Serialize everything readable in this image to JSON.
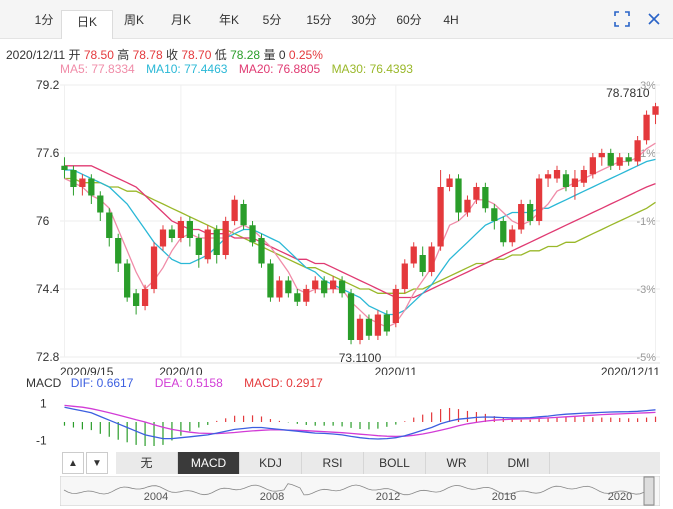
{
  "tabs": [
    "1分",
    "日K",
    "周K",
    "月K",
    "年K",
    "5分",
    "15分",
    "30分",
    "60分",
    "4H"
  ],
  "active_tab": 1,
  "header": {
    "date": "2020/12/11",
    "open_label": "开",
    "open": "78.50",
    "high_label": "高",
    "high": "78.78",
    "close_label": "收",
    "close": "78.70",
    "low_label": "低",
    "low": "78.28",
    "vol_label": "量",
    "vol": "0",
    "change": "0.25%"
  },
  "ma_legend": {
    "ma5": "MA5: 77.8334",
    "ma10": "MA10: 77.4463",
    "ma20": "MA20: 76.8805",
    "ma30": "MA30: 76.4393"
  },
  "colors": {
    "up": "#e4393c",
    "down": "#2a9d2a",
    "ma5": "#f08ca8",
    "ma10": "#2ab8d6",
    "ma20": "#e03a72",
    "ma30": "#9ab82a",
    "dif": "#3c5fe0",
    "dea": "#d23cd6"
  },
  "chart_data": {
    "type": "candlestick",
    "ylim": [
      72.8,
      79.2
    ],
    "y_ticks": [
      "79.2",
      "77.6",
      "76",
      "74.4",
      "72.8"
    ],
    "pct_ticks": [
      "3%",
      "1%",
      "-1%",
      "-3%",
      "-5%"
    ],
    "x_ticks": [
      {
        "label": "2020/9/15",
        "index": 0
      },
      {
        "label": "2020/10",
        "index": 13
      },
      {
        "label": "2020/11",
        "index": 37
      },
      {
        "label": "2020/12/11",
        "index": 66
      }
    ],
    "annotations": {
      "max_label": "78.7810",
      "min_label": "73.1100"
    },
    "candles": [
      [
        77.3,
        77.2,
        77.5,
        77.0
      ],
      [
        77.2,
        76.8,
        77.3,
        76.6
      ],
      [
        76.8,
        77.0,
        77.1,
        76.6
      ],
      [
        77.0,
        76.6,
        77.1,
        76.4
      ],
      [
        76.6,
        76.2,
        76.7,
        76.0
      ],
      [
        76.2,
        75.6,
        76.3,
        75.4
      ],
      [
        75.6,
        75.0,
        75.7,
        74.8
      ],
      [
        75.0,
        74.2,
        75.1,
        74.1
      ],
      [
        74.3,
        74.0,
        74.4,
        73.8
      ],
      [
        74.0,
        74.4,
        74.5,
        73.9
      ],
      [
        74.4,
        75.4,
        75.5,
        74.3
      ],
      [
        75.4,
        75.8,
        75.9,
        75.3
      ],
      [
        75.8,
        75.6,
        75.9,
        75.5
      ],
      [
        75.6,
        76.0,
        76.1,
        75.5
      ],
      [
        76.0,
        75.6,
        76.1,
        75.4
      ],
      [
        75.6,
        75.2,
        75.7,
        74.9
      ],
      [
        75.1,
        75.8,
        75.9,
        75.0
      ],
      [
        75.8,
        75.2,
        75.9,
        75.0
      ],
      [
        75.2,
        76.0,
        76.1,
        75.1
      ],
      [
        76.0,
        76.5,
        76.6,
        75.9
      ],
      [
        76.4,
        75.9,
        76.5,
        75.8
      ],
      [
        75.9,
        75.5,
        76.0,
        75.4
      ],
      [
        75.6,
        75.0,
        75.7,
        74.9
      ],
      [
        75.0,
        74.2,
        75.1,
        74.1
      ],
      [
        74.2,
        74.6,
        74.7,
        74.1
      ],
      [
        74.6,
        74.3,
        74.7,
        74.2
      ],
      [
        74.3,
        74.1,
        74.4,
        74.0
      ],
      [
        74.1,
        74.4,
        74.5,
        74.0
      ],
      [
        74.4,
        74.6,
        74.7,
        74.3
      ],
      [
        74.6,
        74.3,
        74.7,
        74.2
      ],
      [
        74.4,
        74.6,
        74.7,
        74.3
      ],
      [
        74.6,
        74.3,
        74.7,
        74.2
      ],
      [
        74.3,
        73.2,
        74.4,
        73.1
      ],
      [
        73.2,
        73.7,
        73.8,
        73.1
      ],
      [
        73.7,
        73.3,
        73.8,
        73.2
      ],
      [
        73.3,
        73.8,
        73.9,
        73.2
      ],
      [
        73.8,
        73.4,
        73.9,
        73.3
      ],
      [
        73.6,
        74.4,
        74.5,
        73.5
      ],
      [
        74.4,
        75.0,
        75.1,
        74.3
      ],
      [
        75.0,
        75.4,
        75.5,
        74.9
      ],
      [
        75.2,
        74.8,
        75.4,
        74.7
      ],
      [
        74.8,
        75.4,
        75.5,
        74.7
      ],
      [
        75.4,
        76.8,
        77.2,
        75.3
      ],
      [
        76.8,
        77.0,
        77.1,
        76.7
      ],
      [
        77.0,
        76.2,
        77.1,
        76.0
      ],
      [
        76.2,
        76.5,
        76.6,
        76.1
      ],
      [
        76.5,
        76.8,
        76.9,
        76.4
      ],
      [
        76.8,
        76.3,
        76.9,
        76.2
      ],
      [
        76.3,
        76.0,
        76.4,
        75.8
      ],
      [
        76.0,
        75.5,
        76.1,
        75.4
      ],
      [
        75.5,
        75.8,
        75.9,
        75.4
      ],
      [
        75.8,
        76.4,
        76.5,
        75.7
      ],
      [
        76.4,
        76.0,
        76.5,
        75.9
      ],
      [
        76.0,
        77.0,
        77.1,
        75.9
      ],
      [
        77.0,
        77.1,
        77.2,
        76.8
      ],
      [
        77.0,
        77.2,
        77.3,
        76.9
      ],
      [
        77.1,
        76.8,
        77.2,
        76.7
      ],
      [
        76.8,
        77.0,
        77.2,
        76.5
      ],
      [
        76.9,
        77.2,
        77.3,
        76.8
      ],
      [
        77.1,
        77.5,
        77.6,
        77.0
      ],
      [
        77.5,
        77.6,
        77.7,
        77.3
      ],
      [
        77.6,
        77.3,
        77.7,
        77.2
      ],
      [
        77.3,
        77.5,
        77.6,
        77.2
      ],
      [
        77.5,
        77.4,
        77.6,
        77.3
      ],
      [
        77.4,
        77.9,
        78.0,
        77.3
      ],
      [
        77.9,
        78.5,
        78.6,
        77.8
      ],
      [
        78.5,
        78.7,
        78.78,
        78.28
      ]
    ],
    "ma5": [
      77.0,
      76.9,
      76.8,
      76.6,
      76.5,
      76.3,
      75.8,
      75.3,
      74.8,
      74.4,
      74.6,
      74.9,
      75.3,
      75.6,
      75.7,
      75.6,
      75.6,
      75.6,
      75.6,
      75.8,
      75.9,
      75.8,
      75.6,
      75.4,
      75.1,
      74.8,
      74.4,
      74.3,
      74.4,
      74.4,
      74.4,
      74.4,
      74.1,
      73.9,
      73.7,
      73.6,
      73.5,
      73.6,
      73.9,
      74.3,
      74.6,
      74.9,
      75.4,
      75.9,
      76.0,
      76.2,
      76.5,
      76.5,
      76.4,
      76.2,
      76.0,
      75.9,
      76.0,
      76.2,
      76.4,
      76.7,
      76.8,
      76.9,
      77.0,
      77.1,
      77.2,
      77.3,
      77.4,
      77.4,
      77.5,
      77.7,
      77.83
    ],
    "ma10": [
      77.2,
      77.2,
      77.1,
      77.0,
      76.9,
      76.8,
      76.6,
      76.4,
      76.1,
      75.8,
      75.5,
      75.3,
      75.1,
      75.0,
      75.0,
      75.1,
      75.2,
      75.4,
      75.6,
      75.7,
      75.8,
      75.8,
      75.7,
      75.6,
      75.5,
      75.3,
      75.1,
      74.9,
      74.8,
      74.6,
      74.5,
      74.4,
      74.3,
      74.2,
      74.0,
      73.9,
      73.8,
      73.8,
      73.9,
      74.1,
      74.3,
      74.5,
      74.8,
      75.1,
      75.3,
      75.5,
      75.7,
      75.9,
      76.0,
      76.1,
      76.2,
      76.2,
      76.2,
      76.3,
      76.3,
      76.4,
      76.5,
      76.6,
      76.7,
      76.8,
      76.9,
      77.0,
      77.1,
      77.2,
      77.3,
      77.4,
      77.45
    ],
    "ma20": [
      77.3,
      77.3,
      77.3,
      77.3,
      77.2,
      77.1,
      77.0,
      76.9,
      76.8,
      76.6,
      76.4,
      76.2,
      76.0,
      75.9,
      75.8,
      75.8,
      75.7,
      75.7,
      75.7,
      75.6,
      75.6,
      75.6,
      75.5,
      75.4,
      75.3,
      75.2,
      75.1,
      75.1,
      75.0,
      75.0,
      74.9,
      74.8,
      74.7,
      74.6,
      74.5,
      74.4,
      74.3,
      74.2,
      74.2,
      74.2,
      74.3,
      74.4,
      74.5,
      74.6,
      74.7,
      74.8,
      74.9,
      75.0,
      75.1,
      75.2,
      75.3,
      75.4,
      75.5,
      75.6,
      75.7,
      75.8,
      75.9,
      76.0,
      76.1,
      76.2,
      76.3,
      76.4,
      76.5,
      76.6,
      76.7,
      76.8,
      76.88
    ],
    "ma30": [
      77.0,
      77.0,
      76.9,
      76.9,
      76.9,
      76.8,
      76.8,
      76.7,
      76.7,
      76.6,
      76.5,
      76.4,
      76.3,
      76.2,
      76.1,
      76.0,
      75.9,
      75.8,
      75.8,
      75.7,
      75.6,
      75.5,
      75.4,
      75.3,
      75.2,
      75.1,
      75.0,
      74.9,
      74.9,
      74.8,
      74.7,
      74.6,
      74.5,
      74.4,
      74.4,
      74.3,
      74.3,
      74.3,
      74.3,
      74.4,
      74.4,
      74.5,
      74.6,
      74.7,
      74.8,
      74.9,
      75.0,
      75.0,
      75.1,
      75.1,
      75.2,
      75.2,
      75.3,
      75.3,
      75.4,
      75.4,
      75.5,
      75.5,
      75.6,
      75.7,
      75.8,
      75.9,
      76.0,
      76.1,
      76.2,
      76.3,
      76.44
    ],
    "macd": {
      "legend_label": "MACD",
      "dif_label": "DIF: 0.6617",
      "dea_label": "DEA: 0.5158",
      "macd_label": "MACD: 0.2917",
      "y_ticks": [
        "1",
        "-1"
      ],
      "ylim": [
        -1.3,
        1.3
      ],
      "dif": [
        0.8,
        0.7,
        0.6,
        0.5,
        0.3,
        0.1,
        -0.1,
        -0.3,
        -0.5,
        -0.7,
        -0.8,
        -0.9,
        -0.9,
        -0.85,
        -0.8,
        -0.75,
        -0.7,
        -0.6,
        -0.5,
        -0.4,
        -0.35,
        -0.3,
        -0.3,
        -0.35,
        -0.4,
        -0.45,
        -0.5,
        -0.55,
        -0.6,
        -0.62,
        -0.65,
        -0.7,
        -0.78,
        -0.85,
        -0.9,
        -0.92,
        -0.9,
        -0.85,
        -0.75,
        -0.6,
        -0.45,
        -0.3,
        -0.1,
        0.05,
        0.15,
        0.2,
        0.25,
        0.27,
        0.26,
        0.24,
        0.22,
        0.22,
        0.24,
        0.28,
        0.32,
        0.38,
        0.42,
        0.45,
        0.48,
        0.5,
        0.52,
        0.54,
        0.55,
        0.56,
        0.58,
        0.62,
        0.66
      ],
      "dea": [
        0.9,
        0.85,
        0.8,
        0.72,
        0.62,
        0.5,
        0.38,
        0.25,
        0.12,
        0.0,
        -0.15,
        -0.28,
        -0.4,
        -0.48,
        -0.55,
        -0.6,
        -0.62,
        -0.63,
        -0.6,
        -0.57,
        -0.52,
        -0.48,
        -0.45,
        -0.43,
        -0.43,
        -0.44,
        -0.45,
        -0.47,
        -0.5,
        -0.52,
        -0.55,
        -0.58,
        -0.62,
        -0.66,
        -0.7,
        -0.74,
        -0.77,
        -0.78,
        -0.77,
        -0.72,
        -0.65,
        -0.56,
        -0.45,
        -0.33,
        -0.2,
        -0.1,
        -0.02,
        0.05,
        0.1,
        0.13,
        0.15,
        0.16,
        0.18,
        0.2,
        0.22,
        0.25,
        0.28,
        0.31,
        0.34,
        0.37,
        0.4,
        0.42,
        0.44,
        0.46,
        0.48,
        0.5,
        0.52
      ],
      "hist": [
        -0.2,
        -0.3,
        -0.4,
        -0.44,
        -0.64,
        -0.8,
        -0.96,
        -1.1,
        -1.24,
        -1.3,
        -1.3,
        -1.24,
        -1.0,
        -0.74,
        -0.5,
        -0.3,
        -0.16,
        0.06,
        0.2,
        0.34,
        0.34,
        0.36,
        0.3,
        0.16,
        0.06,
        -0.02,
        -0.1,
        -0.16,
        -0.2,
        -0.2,
        -0.2,
        -0.24,
        -0.32,
        -0.38,
        -0.4,
        -0.36,
        -0.26,
        -0.14,
        0.04,
        0.24,
        0.4,
        0.52,
        0.7,
        0.76,
        0.7,
        0.6,
        0.54,
        0.44,
        0.32,
        0.22,
        0.14,
        0.12,
        0.12,
        0.16,
        0.2,
        0.26,
        0.28,
        0.28,
        0.28,
        0.26,
        0.24,
        0.24,
        0.22,
        0.2,
        0.2,
        0.24,
        0.29
      ]
    }
  },
  "bottom_tabs": [
    "无",
    "MACD",
    "KDJ",
    "RSI",
    "BOLL",
    "WR",
    "DMI"
  ],
  "bottom_active": 1,
  "arrows": {
    "up": "▲",
    "down": "▼"
  },
  "timeline": {
    "years": [
      "2004",
      "2008",
      "2012",
      "2016",
      "2020"
    ]
  }
}
